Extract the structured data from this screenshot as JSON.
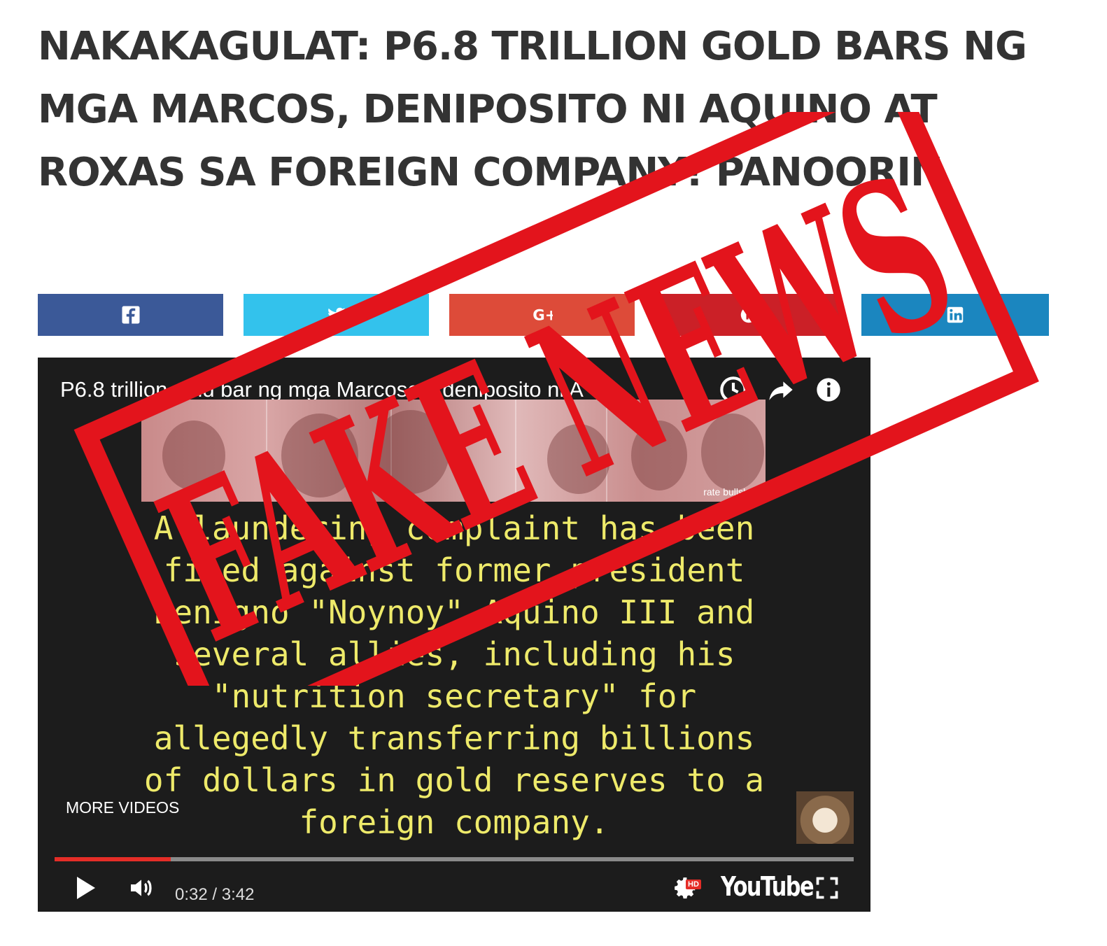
{
  "article": {
    "title": "NAKAKAGULAT: P6.8 TRILLION GOLD BARS NG MGA MARCOS, DENIPOSITO NI AQUINO AT ROXAS SA FOREIGN COMPANY! PANOORIN"
  },
  "share": {
    "buttons": [
      {
        "network": "facebook",
        "icon": "facebook-icon",
        "color": "#3b5998"
      },
      {
        "network": "twitter",
        "icon": "twitter-icon",
        "color": "#33c2ec"
      },
      {
        "network": "google-plus",
        "icon": "google-plus-icon",
        "color": "#dd4b39"
      },
      {
        "network": "pinterest",
        "icon": "pinterest-icon",
        "color": "#cb2027"
      },
      {
        "network": "linkedin",
        "icon": "linkedin-icon",
        "color": "#1b86bf"
      }
    ]
  },
  "video": {
    "title": "P6.8 trillion gold bar ng mga Marcoses, deniposito ni A",
    "photo_caption": "rate bullsh*t.\"",
    "overlay_text": "A laundering complaint has been\nfiled against former president\nBenigno \"Noynoy\" Aquino III and\nseveral allies, including his\n\"nutrition secretary\" for\nallegedly transferring billions\nof dollars in gold reserves to a\nforeign company.",
    "more_videos_label": "MORE VIDEOS",
    "time_display": "0:32 / 3:42",
    "progress_fraction": 0.145,
    "hd_label": "HD",
    "brand_label": "YouTube",
    "icons": [
      "clock-icon",
      "share-icon",
      "info-icon",
      "play-icon",
      "volume-icon",
      "settings-icon",
      "fullscreen-icon"
    ]
  },
  "stamp": {
    "text": "FAKE NEWS",
    "color": "#e3141c"
  }
}
